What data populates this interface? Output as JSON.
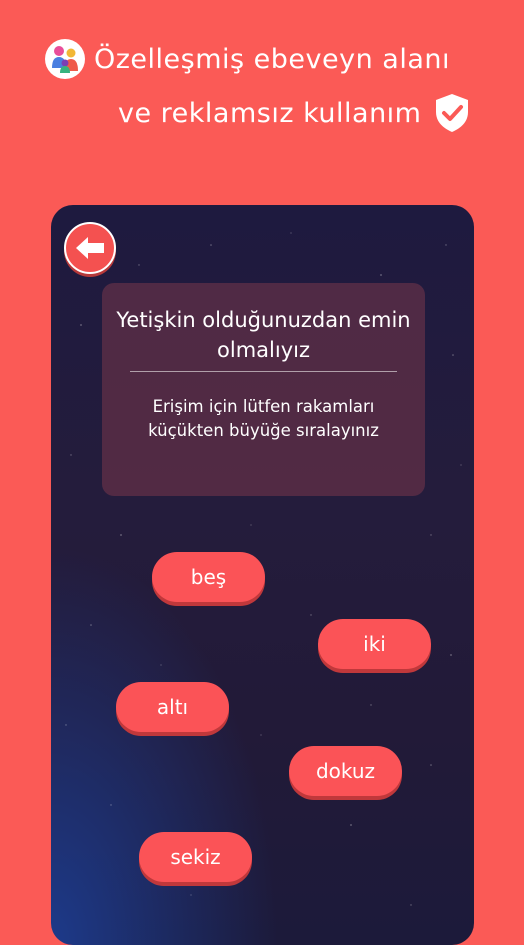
{
  "header": {
    "line1": "Özelleşmiş ebeveyn alanı",
    "line2": "ve reklamsız kullanım",
    "logo_icon": "family-logo-icon",
    "shield_icon": "shield-check-icon"
  },
  "colors": {
    "background": "#fb5a56",
    "button": "#fb5357",
    "panel": "#6e3146"
  },
  "screen": {
    "back_icon": "arrow-left-icon",
    "panel": {
      "title": "Yetişkin olduğunuzdan emin olmalıyız",
      "instructions": "Erişim için lütfen rakamları küçükten büyüğe sıralayınız"
    },
    "number_buttons": [
      "beş",
      "iki",
      "altı",
      "dokuz",
      "sekiz"
    ]
  }
}
